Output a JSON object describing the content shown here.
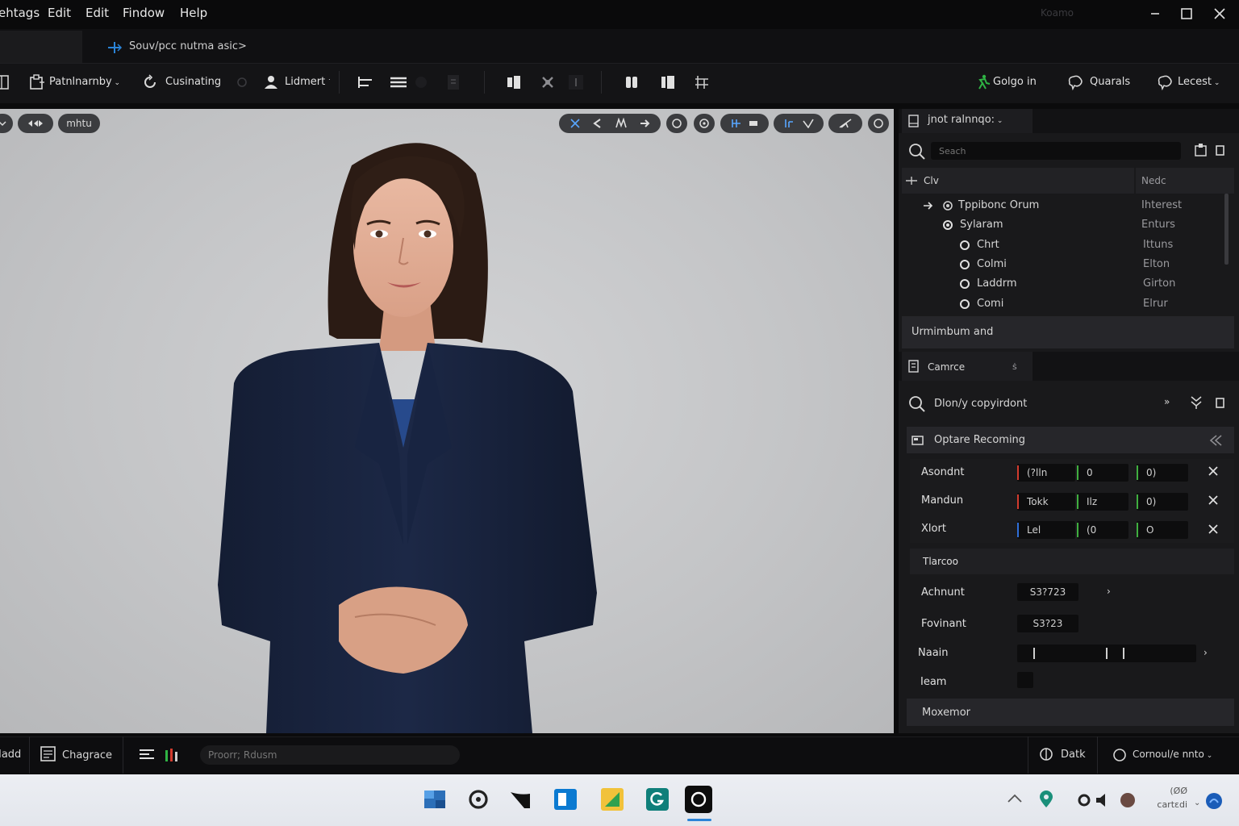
{
  "menubar": {
    "items": [
      "ehtags",
      "Edit",
      "Edit",
      "Findow",
      "Help"
    ],
    "app_title": "Koamo",
    "window_controls": [
      "minimize-icon",
      "maximize-icon",
      "close-icon"
    ]
  },
  "tabs": {
    "document_label": "Souv/pcc nutma asic>"
  },
  "toolbar": {
    "left_items": [
      {
        "label": "Patnlnarnby",
        "icon": "clipboard-icon",
        "has_dropdown": true
      },
      {
        "label": "Cusinating",
        "icon": "refresh-icon",
        "has_dropdown": false
      },
      {
        "label": "Lidmert",
        "icon": "person-icon",
        "has_dropdown": true
      }
    ],
    "right_items": [
      {
        "label": "Golgo in",
        "icon": "runner-icon",
        "accent": "#2fb344"
      },
      {
        "label": "Quarals",
        "icon": "brain-icon"
      },
      {
        "label": "Lecest",
        "icon": "brain-icon",
        "has_dropdown": true
      }
    ]
  },
  "viewport": {
    "left_pills": [
      "mhtu"
    ],
    "background": "#c9cacc"
  },
  "outliner": {
    "tab_label": "jnot ralnnqo:",
    "search_placeholder": "Seach",
    "col_name": "Clv",
    "col_type": "Nedc",
    "rows": [
      {
        "name": "Tppibonc Orum",
        "type": "Ihterest",
        "depth": 0,
        "icon": "arrow-icon"
      },
      {
        "name": "Sylaram",
        "type": "Enturs",
        "depth": 1,
        "icon": "gear-icon"
      },
      {
        "name": "Chrt",
        "type": "Ittuns",
        "depth": 2,
        "icon": "circle-icon"
      },
      {
        "name": "Colmi",
        "type": "Elton",
        "depth": 2,
        "icon": "circle-icon"
      },
      {
        "name": "Laddrm",
        "type": "Girton",
        "depth": 2,
        "icon": "circle-icon"
      },
      {
        "name": "Comi",
        "type": "Elrur",
        "depth": 2,
        "icon": "circle-icon"
      }
    ],
    "footer_label": "Urmimbum and"
  },
  "details": {
    "tab_label": "Camrce",
    "tab_flag": "ṡ",
    "search_text": "Dlon/y copyirdont",
    "section_title": "Optare Recoming",
    "transform_rows": [
      {
        "label": "Asondnt",
        "x": "(?lln",
        "y": "0",
        "z": "0)"
      },
      {
        "label": "Mandun",
        "x": "Tokk",
        "y": "Ilz",
        "z": "0)"
      },
      {
        "label": "Xlort",
        "x": "Lel",
        "y": "(0",
        "z": "O"
      }
    ],
    "subsection_title": "Tlarcoo",
    "fields": [
      {
        "label": "Achnunt",
        "value": "S3?723"
      },
      {
        "label": "Fovinant",
        "value": "S3?23"
      },
      {
        "label": "Naain",
        "value": ""
      },
      {
        "label": "Ieam",
        "value": ""
      }
    ],
    "bottom_section": "Moxemor"
  },
  "statusbar": {
    "items": [
      "Iadd",
      "Chagrace"
    ],
    "command_placeholder": "Proorr; Rdusm",
    "right_items": [
      "Datk",
      "Cornoul/e nnto"
    ]
  },
  "taskbar": {
    "tray_time": "(ØØ",
    "tray_date": "cartɛdi"
  },
  "colors": {
    "accent_blue": "#2a84d8",
    "x_axis": "#d23b2e",
    "y_axis": "#3fae3f",
    "z_axis": "#2f6fd8"
  }
}
